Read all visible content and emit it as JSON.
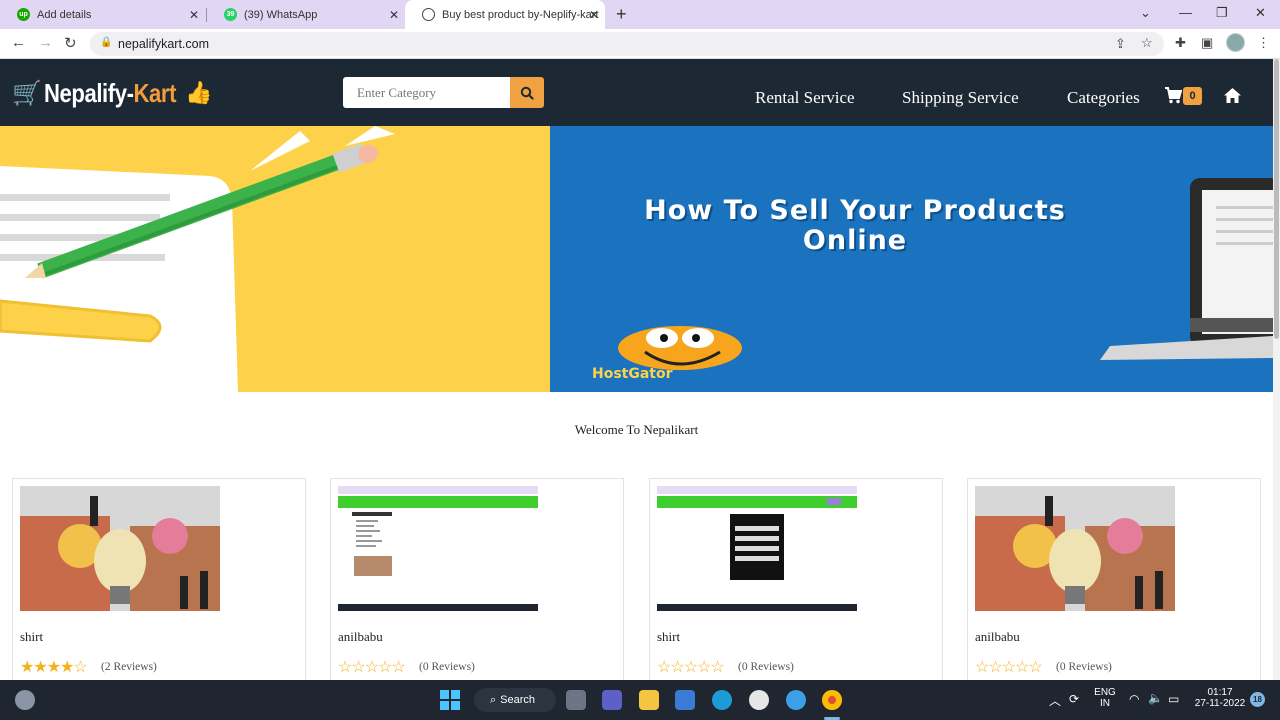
{
  "browser": {
    "tabs": [
      {
        "title": "Add details",
        "favicon_text": "up",
        "favicon_color": "#14a800"
      },
      {
        "title": "(39) WhatsApp",
        "favicon_text": "39",
        "favicon_color": "#25d366"
      },
      {
        "title": "Buy best product by-Neplify-kart",
        "favicon_text": "",
        "favicon_color": "#444444"
      }
    ],
    "url": "nepalifykart.com"
  },
  "site": {
    "brand_main": "Nepalify-",
    "brand_accent": "Kart",
    "search_placeholder": "Enter Category",
    "nav_links": [
      "Rental Service",
      "Shipping Service",
      "Categories"
    ],
    "cart_count": "0",
    "accent_color": "#f0a142",
    "navbar_color": "#1c2833"
  },
  "banner": {
    "headline": "How To Sell Your Products Online",
    "brand": "HostGator"
  },
  "welcome": "Welcome To Nepalikart",
  "products": [
    {
      "name": "shirt",
      "rating": 4,
      "max_rating": 5,
      "reviews": "(2 Reviews)"
    },
    {
      "name": "anilbabu",
      "rating": 0,
      "max_rating": 5,
      "reviews": "(0 Reviews)"
    },
    {
      "name": "shirt",
      "rating": 0,
      "max_rating": 5,
      "reviews": "(0 Reviews)"
    },
    {
      "name": "anilbabu",
      "rating": 0,
      "max_rating": 5,
      "reviews": "(0 Reviews)"
    }
  ],
  "taskbar": {
    "search_label": "Search",
    "language": "ENG",
    "region": "IN",
    "time": "01:17",
    "date": "27-11-2022",
    "notifications": "18"
  }
}
